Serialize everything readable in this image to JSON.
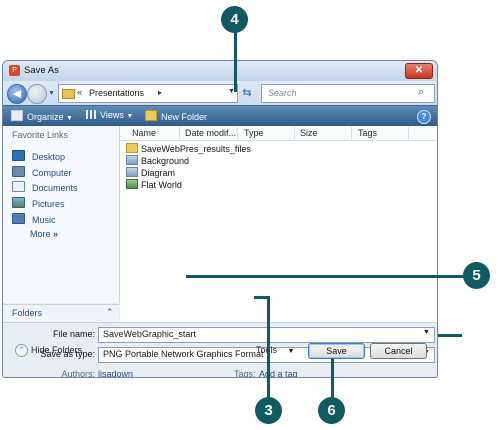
{
  "window": {
    "title": "Save As"
  },
  "nav": {
    "address_chevron": "«",
    "address_text": "Presentations",
    "address_arrow": "▸",
    "search_placeholder": "Search"
  },
  "toolbar": {
    "organize": "Organize",
    "views": "Views",
    "new_folder": "New Folder",
    "help": "?"
  },
  "sidebar": {
    "title": "Favorite Links",
    "items": [
      {
        "label": "Desktop",
        "icon": "desktop-icon"
      },
      {
        "label": "Computer",
        "icon": "computer-icon"
      },
      {
        "label": "Documents",
        "icon": "documents-icon"
      },
      {
        "label": "Pictures",
        "icon": "pictures-icon"
      },
      {
        "label": "Music",
        "icon": "music-icon"
      }
    ],
    "more": "More",
    "more_chev": "»",
    "folders": "Folders"
  },
  "columns": [
    "Name",
    "Date modif...",
    "Type",
    "Size",
    "Tags"
  ],
  "files": [
    {
      "name": "SaveWebPres_results_files",
      "icon": "folder-icon"
    },
    {
      "name": "Background",
      "icon": "image-icon"
    },
    {
      "name": "Diagram",
      "icon": "image-icon"
    },
    {
      "name": "Flat World",
      "icon": "image-icon"
    }
  ],
  "form": {
    "file_name_label": "File name:",
    "file_name_value": "SaveWebGraphic_start",
    "save_type_label": "Save as type:",
    "save_type_value": "PNG Portable Network Graphics Format",
    "authors_label": "Authors:",
    "authors_value": "lisadown",
    "tags_label": "Tags:",
    "tags_value": "Add a tag"
  },
  "footer": {
    "hide_folders": "Hide Folders",
    "tools": "Tools",
    "save": "Save",
    "cancel": "Cancel"
  },
  "callouts": {
    "c4": "4",
    "c5": "5",
    "c3": "3",
    "c6": "6"
  },
  "colors": {
    "toolbar": "#2b5886",
    "callout": "#0f5a63"
  }
}
